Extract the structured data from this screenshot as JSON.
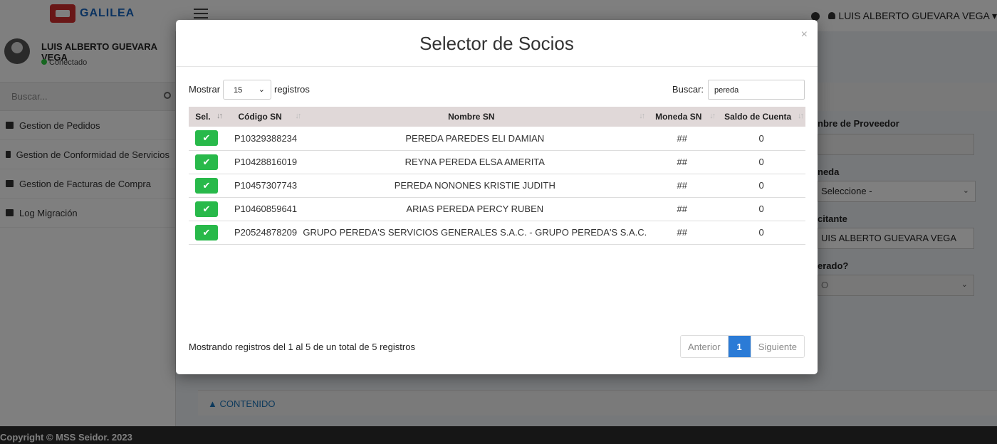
{
  "app": {
    "logo_text": "GALILEA",
    "user_name": "LUIS ALBERTO GUEVARA VEGA",
    "status": "Conectado",
    "search_placeholder": "Buscar...",
    "menu": [
      {
        "label": "Gestion de Pedidos",
        "icon": "truck-icon"
      },
      {
        "label": "Gestion de Conformidad de Servicios",
        "icon": "check-square-icon"
      },
      {
        "label": "Gestion de Facturas de Compra",
        "icon": "credit-card-icon"
      },
      {
        "label": "Log Migración",
        "icon": "send-icon"
      }
    ],
    "right_panel": {
      "proveedor_label": "nbre de Proveedor",
      "moneda_label": "neda",
      "moneda_value": "Seleccione -",
      "solicitante_label": "citante",
      "solicitante_value": "UIS ALBERTO GUEVARA VEGA",
      "generado_label": "erado?",
      "generado_value": "O"
    },
    "contenido_label": "CONTENIDO",
    "footer": "Copyright © MSS Seidor. 2023"
  },
  "modal": {
    "title": "Selector de Socios",
    "close": "×",
    "length_label": "Mostrar",
    "length_value": "15",
    "length_suffix": "registros",
    "search_label": "Buscar:",
    "search_value": "pereda",
    "columns": [
      "Sel.",
      "Código SN",
      "Nombre SN",
      "Moneda SN",
      "Saldo de Cuenta"
    ],
    "rows": [
      {
        "code": "P10329388234",
        "name": "PEREDA PAREDES ELI DAMIAN",
        "moneda": "##",
        "saldo": "0"
      },
      {
        "code": "P10428816019",
        "name": "REYNA PEREDA ELSA AMERITA",
        "moneda": "##",
        "saldo": "0"
      },
      {
        "code": "P10457307743",
        "name": "PEREDA NONONES KRISTIE JUDITH",
        "moneda": "##",
        "saldo": "0"
      },
      {
        "code": "P10460859641",
        "name": "ARIAS PEREDA PERCY RUBEN",
        "moneda": "##",
        "saldo": "0"
      },
      {
        "code": "P20524878209",
        "name": "GRUPO PEREDA'S SERVICIOS GENERALES S.A.C. - GRUPO PEREDA'S S.A.C.",
        "moneda": "##",
        "saldo": "0"
      }
    ],
    "info": "Mostrando registros del 1 al 5 de un total de 5 registros",
    "pager": {
      "prev": "Anterior",
      "current": "1",
      "next": "Siguiente"
    }
  }
}
